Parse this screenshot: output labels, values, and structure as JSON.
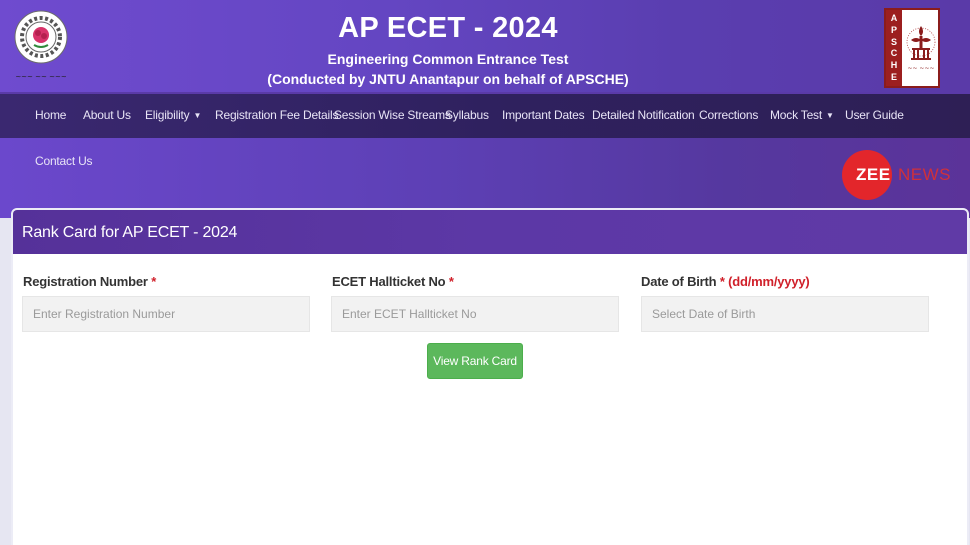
{
  "header": {
    "title": "AP ECET - 2024",
    "subtitle": "Engineering Common Entrance Test",
    "conducted_by": "(Conducted by JNTU Anantapur on behalf of APSCHE)",
    "left_logo": "jntu-anantapur-logo",
    "right_logo": "apsche-logo",
    "right_logo_letters": [
      "A",
      "P",
      "S",
      "C",
      "H",
      "E"
    ]
  },
  "nav": {
    "items": [
      {
        "label": "Home",
        "dropdown": false
      },
      {
        "label": "About Us",
        "dropdown": false
      },
      {
        "label": "Eligibility",
        "dropdown": true
      },
      {
        "label": "Registration Fee Details",
        "dropdown": false
      },
      {
        "label": "Session Wise Streams",
        "dropdown": false
      },
      {
        "label": "Syllabus",
        "dropdown": false
      },
      {
        "label": "Important Dates",
        "dropdown": false
      },
      {
        "label": "Detailed Notification",
        "dropdown": false
      },
      {
        "label": "Corrections",
        "dropdown": false
      },
      {
        "label": "Mock Test",
        "dropdown": true
      },
      {
        "label": "User Guide",
        "dropdown": false
      },
      {
        "label": "Contact Us",
        "dropdown": false
      }
    ],
    "caret_glyph": "▼"
  },
  "watermark": {
    "zee": "ZEE",
    "news": "NEWS"
  },
  "form": {
    "title": "Rank Card for AP ECET - 2024",
    "required_mark": "*",
    "fields": [
      {
        "label": "Registration Number",
        "placeholder": "Enter Registration Number",
        "value": "",
        "hint": ""
      },
      {
        "label": "ECET Hallticket No",
        "placeholder": "Enter ECET Hallticket No",
        "value": "",
        "hint": ""
      },
      {
        "label": "Date of Birth",
        "placeholder": "Select Date of Birth",
        "value": "",
        "hint": "(dd/mm/yyyy)"
      }
    ],
    "submit_label": "View Rank Card"
  },
  "colors": {
    "header_purple": "#6446c2",
    "nav_dark": "#2f215f",
    "card_header": "#5c38a6",
    "button_green": "#5cb85c",
    "required_red": "#d0202a",
    "zee_red": "#e3262b"
  }
}
